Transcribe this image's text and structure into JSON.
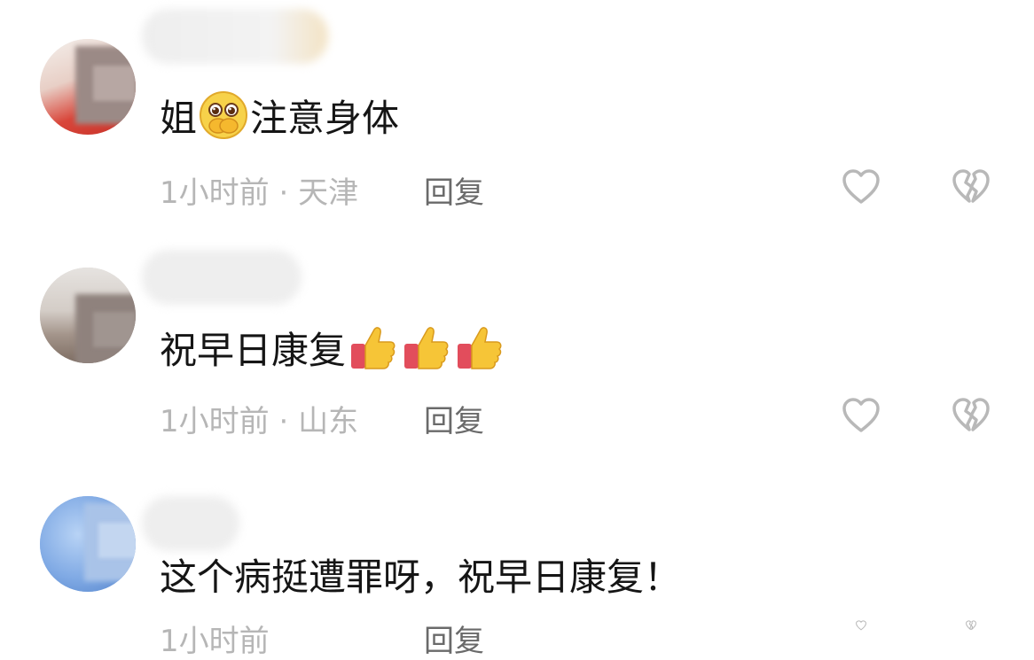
{
  "comments": [
    {
      "text_before": "姐",
      "emoji": "hands-over-mouth-emoji",
      "text_after": "注意身体",
      "time": "1小时前",
      "separator": "·",
      "location": "天津",
      "reply_label": "回复"
    },
    {
      "text_before": "祝早日康复",
      "emoji": "thumbs-up-emoji",
      "emoji_count": 3,
      "time": "1小时前",
      "separator": "·",
      "location": "山东",
      "reply_label": "回复"
    },
    {
      "text": "这个病挺遭罪呀，祝早日康复！",
      "time": "1小时前",
      "reply_label": "回复"
    }
  ],
  "icons": {
    "like": "heart-outline-icon",
    "dislike": "broken-heart-icon"
  },
  "colors": {
    "text": "#151515",
    "meta": "#b6b6b6",
    "reply": "#6a6a6a",
    "icon": "#b8b8b8"
  }
}
